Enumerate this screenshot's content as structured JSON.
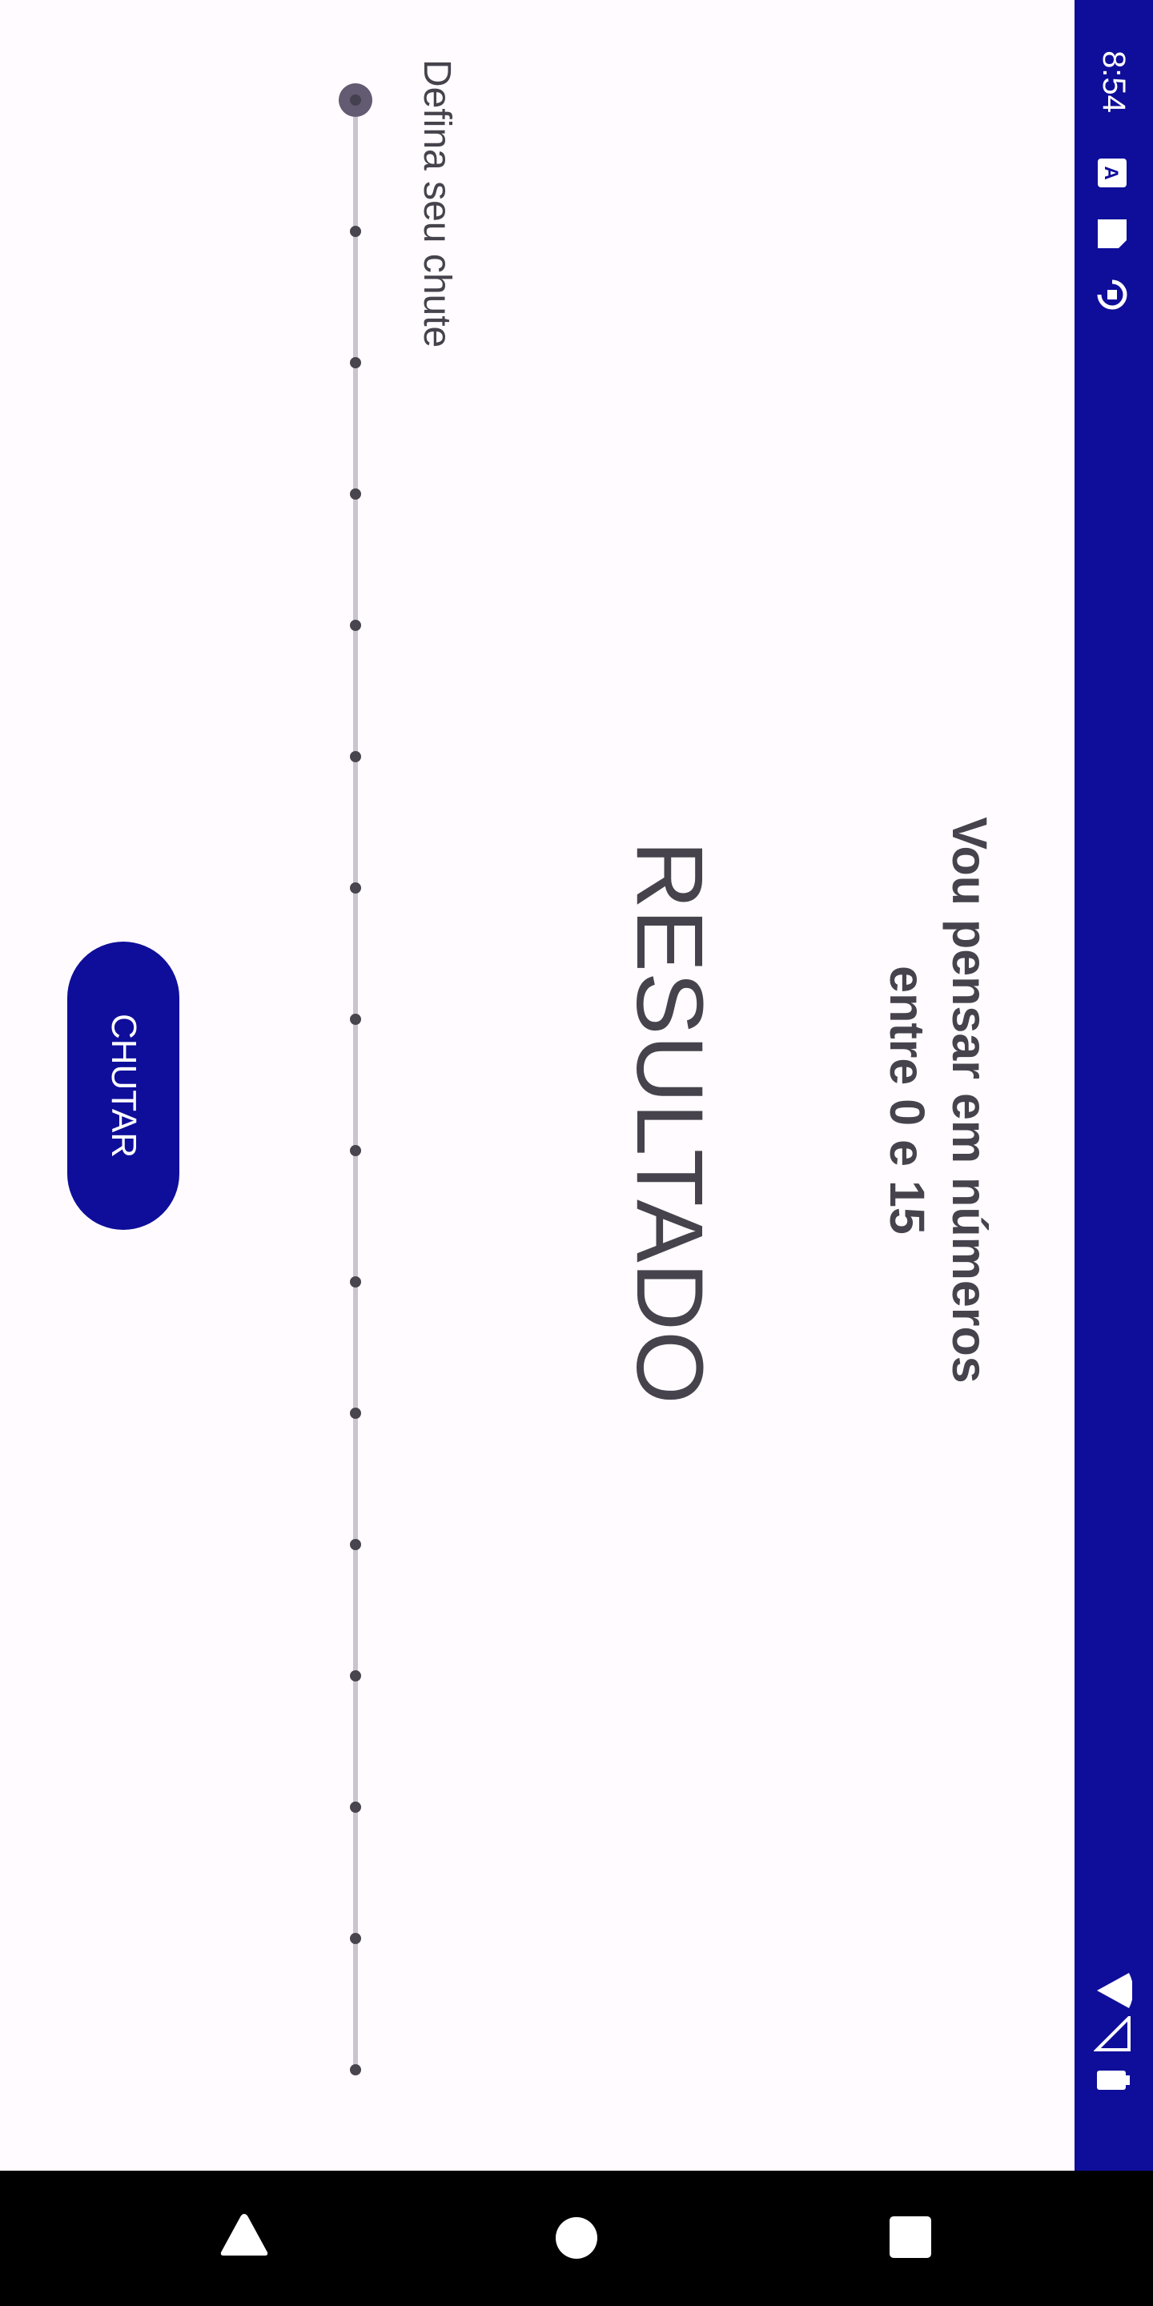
{
  "status_bar": {
    "time": "8:54",
    "background_color": "#0f0e9a",
    "left_icons": [
      "a-notification-icon",
      "sd-card-icon",
      "sync-icon"
    ],
    "right_icons": [
      "wifi-icon",
      "signal-icon",
      "battery-icon"
    ]
  },
  "main": {
    "heading": "Vou pensar em números entre 0 e 15",
    "result": "RESULTADO",
    "slider": {
      "label": "Defina seu chute",
      "value": 0,
      "min": 0,
      "max": 15,
      "steps": 16
    },
    "guess_button": {
      "label": "CHUTAR",
      "color": "#0f0e9a"
    }
  },
  "nav_bar": {
    "buttons": [
      "back-icon",
      "home-icon",
      "recents-icon"
    ]
  }
}
